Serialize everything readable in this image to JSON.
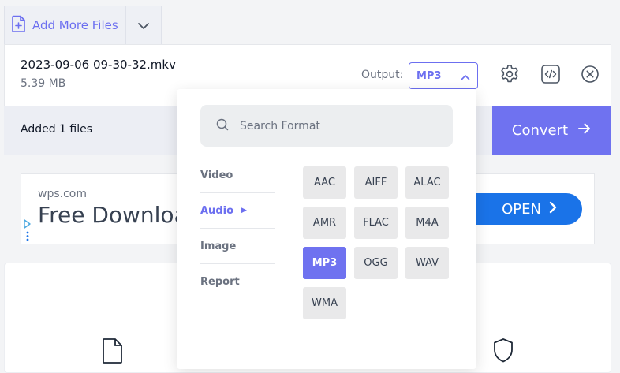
{
  "toolbar": {
    "add_files_label": "Add More Files"
  },
  "file": {
    "name": "2023-09-06 09-30-32.mkv",
    "size": "5.39 MB",
    "output_label": "Output:",
    "output_value": "MP3"
  },
  "status": {
    "added_text": "Added 1 files"
  },
  "convert": {
    "label": "Convert"
  },
  "ad": {
    "domain": "wps.com",
    "title": "Free Download",
    "open_label": "OPEN"
  },
  "dropdown": {
    "search_placeholder": "Search Format",
    "categories": [
      "Video",
      "Audio",
      "Image",
      "Report"
    ],
    "active_category": "Audio",
    "formats": [
      "AAC",
      "AIFF",
      "ALAC",
      "AMR",
      "FLAC",
      "M4A",
      "MP3",
      "OGG",
      "WAV",
      "WMA"
    ],
    "selected_format": "MP3"
  },
  "colors": {
    "accent": "#6f72f0",
    "ad_blue": "#1a73e8"
  }
}
